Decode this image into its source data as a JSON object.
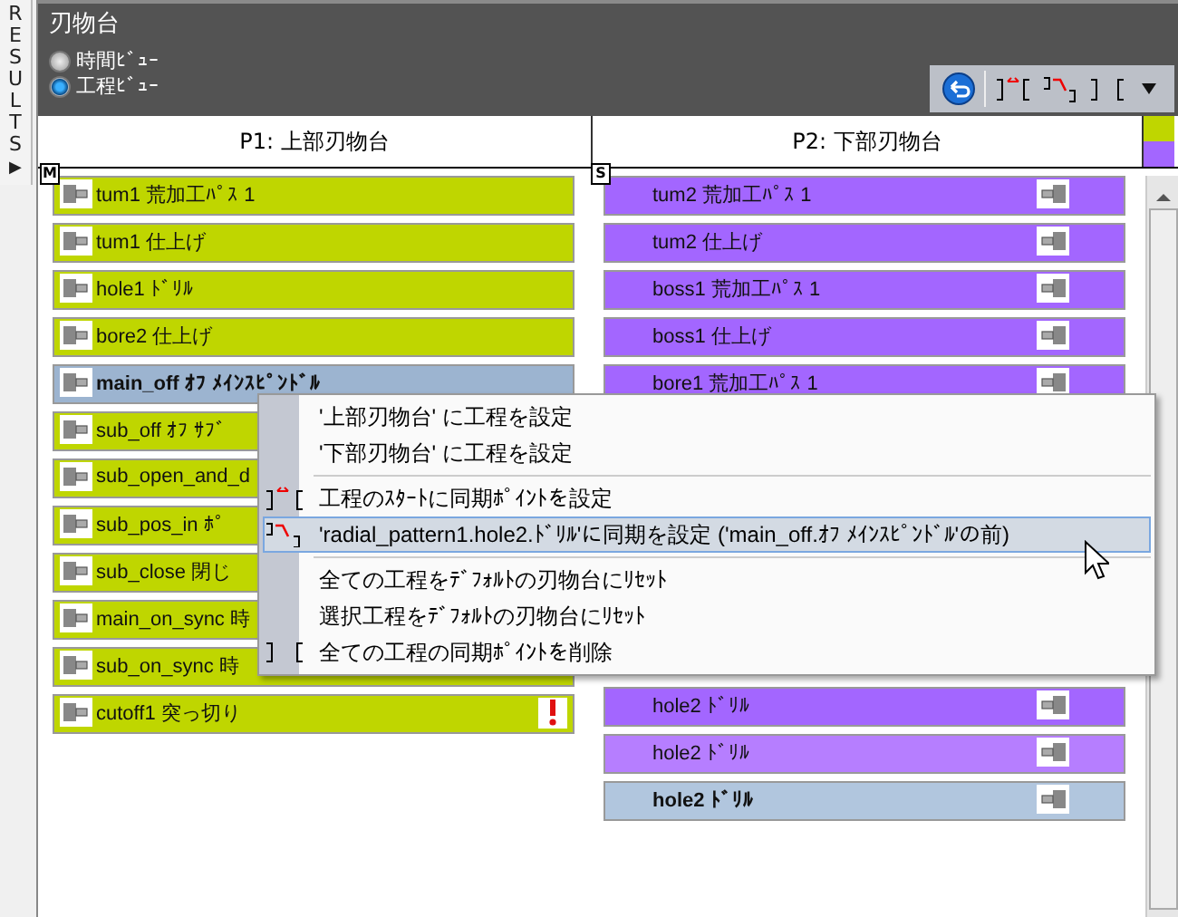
{
  "side_tab": {
    "letters": [
      "R",
      "E",
      "S",
      "U",
      "L",
      "T",
      "S"
    ],
    "arrow": "▶"
  },
  "panel": {
    "title": "刃物台",
    "views": [
      {
        "label": "時間ﾋﾞｭｰ",
        "selected": false
      },
      {
        "label": "工程ﾋﾞｭｰ",
        "selected": true
      }
    ]
  },
  "columns": [
    {
      "header": "P1: 上部刃物台",
      "badge": "M",
      "color": "#bfd600",
      "rows": [
        {
          "text": "tum1 荒加工ﾊﾟｽ 1",
          "selected": false,
          "warning": false
        },
        {
          "text": "tum1 仕上げ",
          "selected": false,
          "warning": false
        },
        {
          "text": "hole1 ﾄﾞﾘﾙ",
          "selected": false,
          "warning": false
        },
        {
          "text": "bore2 仕上げ",
          "selected": false,
          "warning": false
        },
        {
          "text": "main_off  ｵﾌ ﾒｲﾝｽﾋﾟﾝﾄﾞﾙ",
          "selected": true,
          "warning": false
        },
        {
          "text": "sub_off ｵﾌ ｻﾌﾞ",
          "selected": false,
          "warning": false
        },
        {
          "text": "sub_open_and_d",
          "selected": false,
          "warning": false
        },
        {
          "text": "sub_pos_in ﾎﾟ",
          "selected": false,
          "warning": false
        },
        {
          "text": "sub_close 閉じ",
          "selected": false,
          "warning": false
        },
        {
          "text": "main_on_sync 時",
          "selected": false,
          "warning": false
        },
        {
          "text": "sub_on_sync 時",
          "selected": false,
          "warning": false
        },
        {
          "text": "cutoff1 突っ切り",
          "selected": false,
          "warning": true
        }
      ]
    },
    {
      "header": "P2: 下部刃物台",
      "badge": "S",
      "color": "#a366ff",
      "rows_top": [
        {
          "text": "tum2 荒加工ﾊﾟｽ 1",
          "selected": false,
          "color": "#a366ff"
        },
        {
          "text": "tum2 仕上げ",
          "selected": false,
          "color": "#a366ff"
        },
        {
          "text": "boss1 荒加工ﾊﾟｽ 1",
          "selected": false,
          "color": "#a366ff"
        },
        {
          "text": "boss1 仕上げ",
          "selected": false,
          "color": "#a366ff"
        },
        {
          "text": "bore1 荒加工ﾊﾟｽ 1",
          "selected": false,
          "color": "#a366ff"
        }
      ],
      "rows_bottom": [
        {
          "text": "hole2 ﾄﾞﾘﾙ",
          "selected": false,
          "color": "#a366ff"
        },
        {
          "text": "hole2 ﾄﾞﾘﾙ",
          "selected": false,
          "color": "#b67eff"
        },
        {
          "text": "hole2 ﾄﾞﾘﾙ",
          "selected": true
        }
      ]
    }
  ],
  "context_menu": [
    {
      "kind": "item",
      "label": "'上部刃物台' に工程を設定",
      "selected": false
    },
    {
      "kind": "item",
      "label": "'下部刃物台' に工程を設定",
      "selected": false
    },
    {
      "kind": "separator"
    },
    {
      "kind": "item",
      "label": "工程のｽﾀｰﾄに同期ﾎﾟｲﾝﾄを設定",
      "selected": false
    },
    {
      "kind": "item",
      "label": "'radial_pattern1.hole2.ﾄﾞﾘﾙ'に同期を設定 ('main_off.ｵﾌ ﾒｲﾝｽﾋﾟﾝﾄﾞﾙ'の前)",
      "selected": true
    },
    {
      "kind": "separator"
    },
    {
      "kind": "item",
      "label": "全ての工程をﾃﾞﾌｫﾙﾄの刃物台にﾘｾｯﾄ",
      "selected": false
    },
    {
      "kind": "item",
      "label": "選択工程をﾃﾞﾌｫﾙﾄの刃物台にﾘｾｯﾄ",
      "selected": false
    },
    {
      "kind": "item",
      "label": "全ての工程の同期ﾎﾟｲﾝﾄを削除",
      "selected": false
    }
  ]
}
